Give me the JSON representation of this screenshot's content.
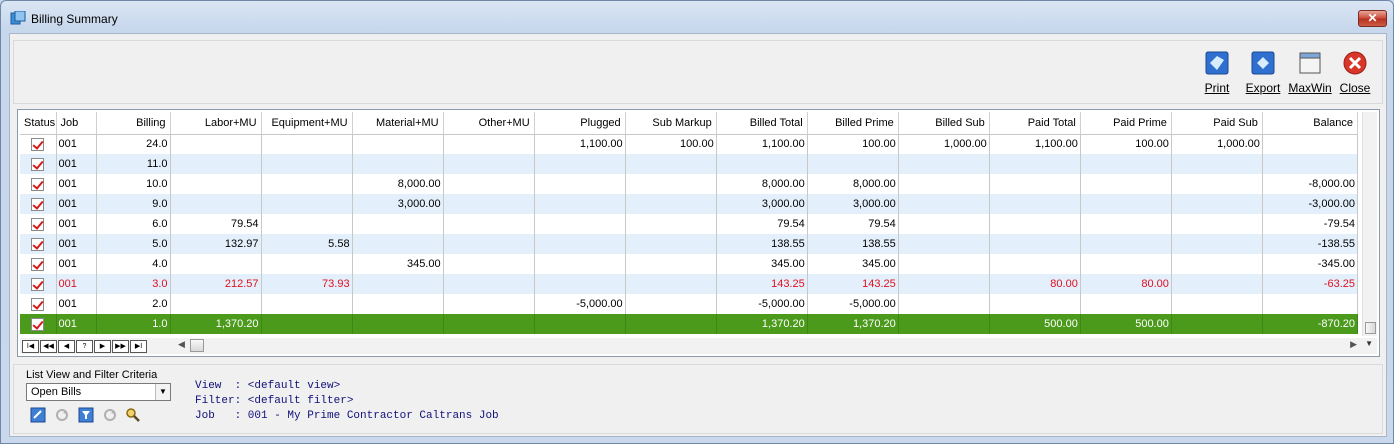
{
  "window": {
    "title": "Billing Summary",
    "close_glyph": "✕"
  },
  "toolbar": {
    "buttons": [
      {
        "label": "Print",
        "icon": "print-icon"
      },
      {
        "label": "Export",
        "icon": "export-icon"
      },
      {
        "label": "MaxWin",
        "icon": "maxwin-icon"
      },
      {
        "label": "Close",
        "icon": "close-icon"
      }
    ]
  },
  "grid": {
    "columns": [
      "Status",
      "Job",
      "Billing",
      "Labor+MU",
      "Equipment+MU",
      "Material+MU",
      "Other+MU",
      "Plugged",
      "Sub Markup",
      "Billed Total",
      "Billed Prime",
      "Billed Sub",
      "Paid Total",
      "Paid Prime",
      "Paid Sub",
      "Balance"
    ],
    "rows": [
      {
        "job": "001",
        "billing": "24.0",
        "labor": "",
        "equipment": "",
        "material": "",
        "other": "",
        "plugged": "1,100.00",
        "sub_markup": "100.00",
        "billed_total": "1,100.00",
        "billed_prime": "100.00",
        "billed_sub": "1,000.00",
        "paid_total": "1,100.00",
        "paid_prime": "100.00",
        "paid_sub": "1,000.00",
        "balance": ""
      },
      {
        "job": "001",
        "billing": "11.0",
        "labor": "",
        "equipment": "",
        "material": "",
        "other": "",
        "plugged": "",
        "sub_markup": "",
        "billed_total": "",
        "billed_prime": "",
        "billed_sub": "",
        "paid_total": "",
        "paid_prime": "",
        "paid_sub": "",
        "balance": ""
      },
      {
        "job": "001",
        "billing": "10.0",
        "labor": "",
        "equipment": "",
        "material": "8,000.00",
        "other": "",
        "plugged": "",
        "sub_markup": "",
        "billed_total": "8,000.00",
        "billed_prime": "8,000.00",
        "billed_sub": "",
        "paid_total": "",
        "paid_prime": "",
        "paid_sub": "",
        "balance": "-8,000.00"
      },
      {
        "job": "001",
        "billing": "9.0",
        "labor": "",
        "equipment": "",
        "material": "3,000.00",
        "other": "",
        "plugged": "",
        "sub_markup": "",
        "billed_total": "3,000.00",
        "billed_prime": "3,000.00",
        "billed_sub": "",
        "paid_total": "",
        "paid_prime": "",
        "paid_sub": "",
        "balance": "-3,000.00"
      },
      {
        "job": "001",
        "billing": "6.0",
        "labor": "79.54",
        "equipment": "",
        "material": "",
        "other": "",
        "plugged": "",
        "sub_markup": "",
        "billed_total": "79.54",
        "billed_prime": "79.54",
        "billed_sub": "",
        "paid_total": "",
        "paid_prime": "",
        "paid_sub": "",
        "balance": "-79.54"
      },
      {
        "job": "001",
        "billing": "5.0",
        "labor": "132.97",
        "equipment": "5.58",
        "material": "",
        "other": "",
        "plugged": "",
        "sub_markup": "",
        "billed_total": "138.55",
        "billed_prime": "138.55",
        "billed_sub": "",
        "paid_total": "",
        "paid_prime": "",
        "paid_sub": "",
        "balance": "-138.55"
      },
      {
        "job": "001",
        "billing": "4.0",
        "labor": "",
        "equipment": "",
        "material": "345.00",
        "other": "",
        "plugged": "",
        "sub_markup": "",
        "billed_total": "345.00",
        "billed_prime": "345.00",
        "billed_sub": "",
        "paid_total": "",
        "paid_prime": "",
        "paid_sub": "",
        "balance": "-345.00"
      },
      {
        "job": "001",
        "billing": "3.0",
        "labor": "212.57",
        "equipment": "73.93",
        "material": "",
        "other": "",
        "plugged": "",
        "sub_markup": "",
        "billed_total": "143.25",
        "billed_prime": "143.25",
        "billed_sub": "",
        "paid_total": "80.00",
        "paid_prime": "80.00",
        "paid_sub": "",
        "balance": "-63.25"
      },
      {
        "job": "001",
        "billing": "2.0",
        "labor": "",
        "equipment": "",
        "material": "",
        "other": "",
        "plugged": "-5,000.00",
        "sub_markup": "",
        "billed_total": "-5,000.00",
        "billed_prime": "-5,000.00",
        "billed_sub": "",
        "paid_total": "",
        "paid_prime": "",
        "paid_sub": "",
        "balance": ""
      },
      {
        "job": "001",
        "billing": "1.0",
        "labor": "1,370.20",
        "equipment": "",
        "material": "",
        "other": "",
        "plugged": "",
        "sub_markup": "",
        "billed_total": "1,370.20",
        "billed_prime": "1,370.20",
        "billed_sub": "",
        "paid_total": "500.00",
        "paid_prime": "500.00",
        "paid_sub": "",
        "balance": "-870.20"
      }
    ],
    "nav_buttons": [
      "I◀",
      "◀◀",
      "◀",
      "?",
      "▶",
      "▶▶",
      "▶I"
    ],
    "scroll_glyphs": {
      "left": "◀",
      "right": "▶",
      "down": "▼"
    }
  },
  "filter": {
    "label": "List View and Filter Criteria",
    "selected": "Open Bills",
    "arrow_glyph": "▼",
    "info": {
      "view": "View  : <default view>",
      "filter": "Filter: <default filter>",
      "job": "Job   : 001 - My Prime Contractor Caltrans Job"
    }
  },
  "colors": {
    "selected_row": "#4b9a1c",
    "alt_row": "#e4effc",
    "red_text": "#e0101e",
    "info_text": "#10107a"
  }
}
